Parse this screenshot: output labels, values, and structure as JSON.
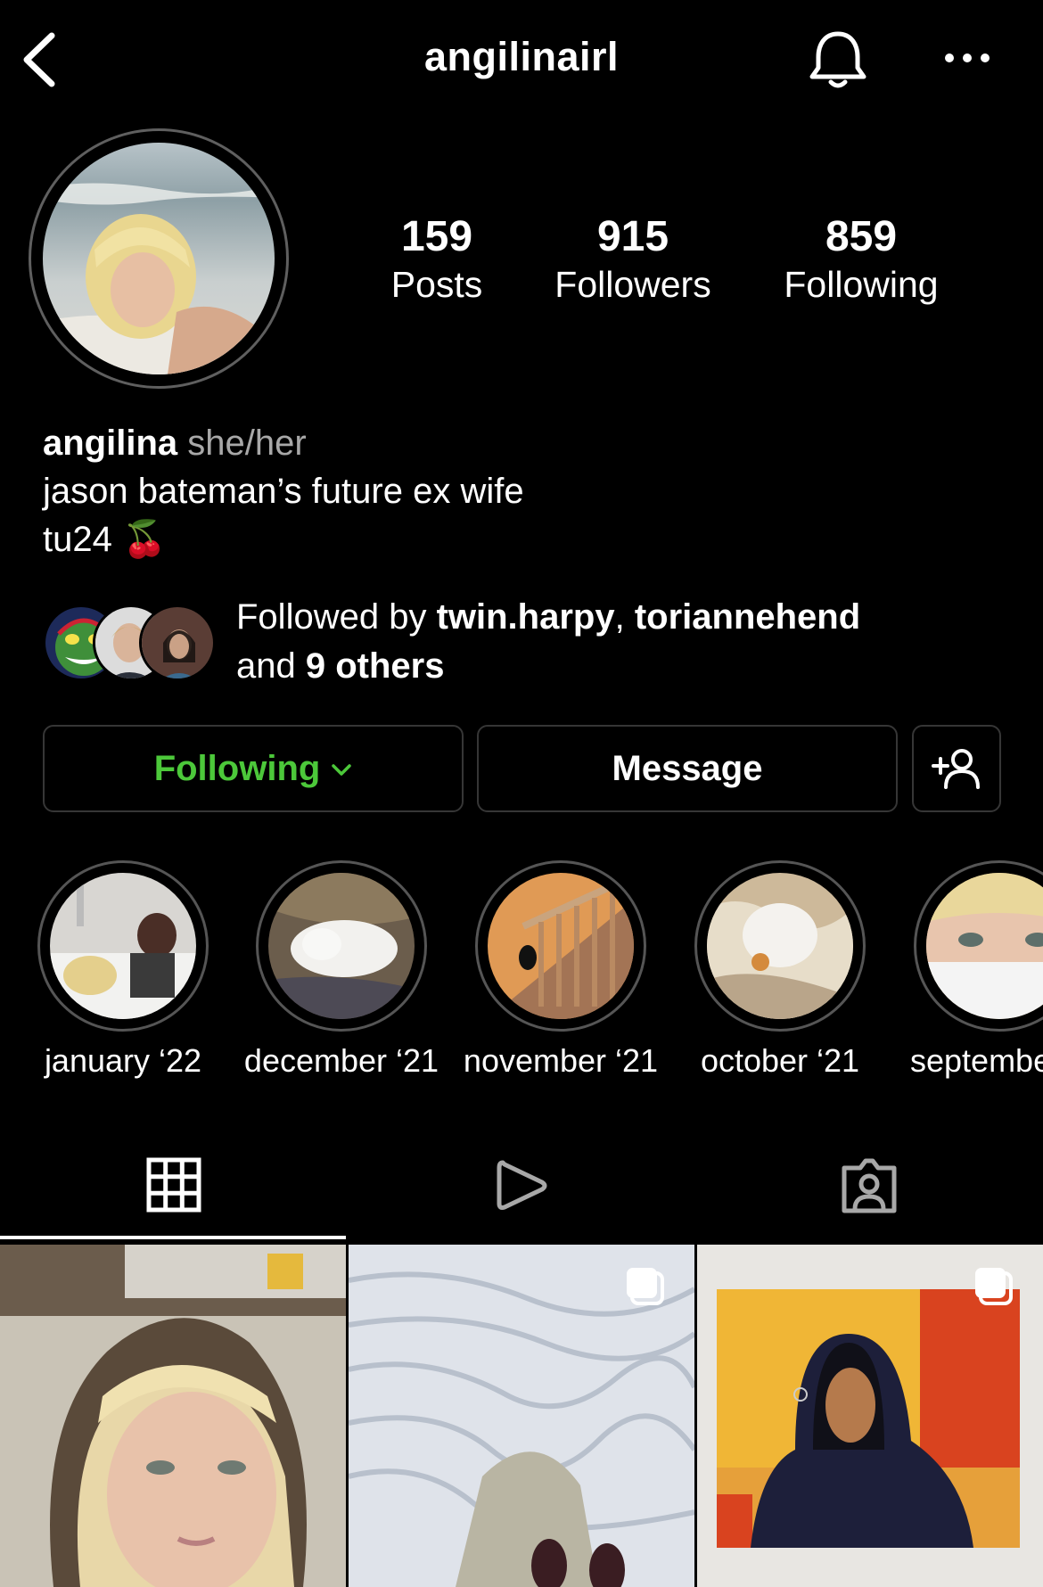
{
  "header": {
    "username": "angilinairl",
    "back_icon": "chevron-left-icon",
    "bell_icon": "bell-icon",
    "more_icon": "more-horizontal-icon"
  },
  "stats": {
    "posts": {
      "count": "159",
      "label": "Posts"
    },
    "followers": {
      "count": "915",
      "label": "Followers"
    },
    "following": {
      "count": "859",
      "label": "Following"
    }
  },
  "bio": {
    "name": "angilina",
    "pronouns": "she/her",
    "line1": "jason bateman’s future ex wife",
    "line2": "tu24",
    "emoji": "🍒"
  },
  "followed_by": {
    "prefix": "Followed by ",
    "user1": "twin.harpy",
    "separator": ", ",
    "user2": "toriannehend",
    "and": "and ",
    "others": "9 others"
  },
  "actions": {
    "following_label": "Following",
    "message_label": "Message",
    "add_icon": "add-person-icon"
  },
  "highlights": [
    {
      "label": "january ‘22"
    },
    {
      "label": "december ‘21"
    },
    {
      "label": "november ‘21"
    },
    {
      "label": "october ‘21"
    },
    {
      "label": "septembe"
    }
  ],
  "tabs": {
    "grid_icon": "grid-icon",
    "reels_icon": "play-icon",
    "tagged_icon": "tagged-person-icon",
    "active": "grid"
  },
  "colors": {
    "accent_green": "#4cc83a",
    "background": "#000000",
    "border": "#363636",
    "secondary_text": "#a8a8a8"
  }
}
